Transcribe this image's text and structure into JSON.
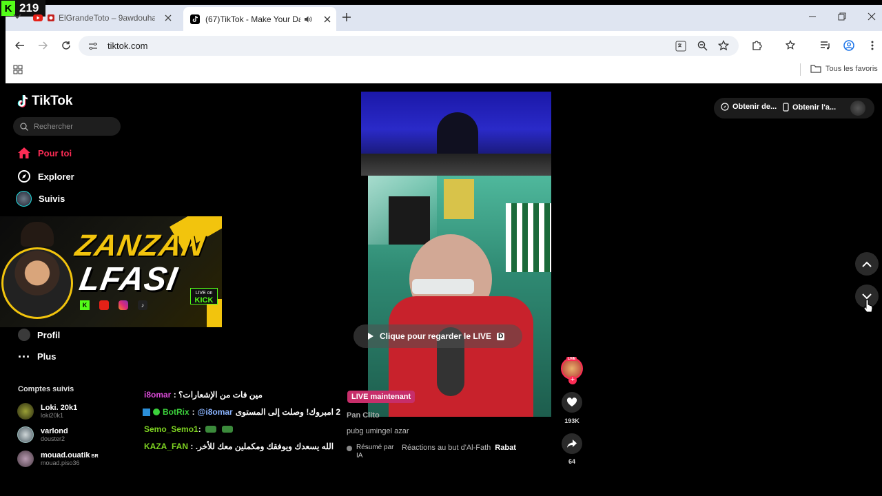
{
  "kick_badge": {
    "count": "219"
  },
  "tabs": [
    {
      "title": "ElGrandeToto – 9awdouha (",
      "active": false,
      "icon": "youtube-icon"
    },
    {
      "title": "(67)TikTok - Make Your Day",
      "active": true,
      "icon": "tiktok-icon"
    }
  ],
  "address_bar": {
    "url": "tiktok.com"
  },
  "bookmarks_bar": {
    "folder_label": "Tous les favoris"
  },
  "tiktok": {
    "logo_text": "TikTok",
    "search_placeholder": "Rechercher",
    "nav": [
      {
        "label": "Pour toi",
        "icon": "home-icon",
        "active": true
      },
      {
        "label": "Explorer",
        "icon": "compass-icon"
      },
      {
        "label": "Suivis",
        "icon": "following-icon"
      },
      {
        "label": "Profil",
        "icon": "profile-icon"
      },
      {
        "label": "Plus",
        "icon": "more-icon"
      }
    ],
    "followed_heading": "Comptes suivis",
    "followed": [
      {
        "name": "Loki. 20k1",
        "handle": "loki20k1"
      },
      {
        "name": "varlond",
        "handle": "douster2"
      },
      {
        "name": "mouad.ouatik",
        "badge": "BR",
        "handle": "mouad.piso36"
      }
    ],
    "top_right": {
      "get_app": "Obtenir de...",
      "get_mobile": "Obtenir l'a..."
    },
    "video": {
      "overlay_text": "Clique pour regarder le LIVE",
      "overlay_key": "D",
      "live_badge": "LIVE maintenant",
      "creator": "Pan Clito",
      "description": "pubg umingel azar",
      "ai_summary_label": "Résumé par IA",
      "related_text": "Réactions au but d'Al-Fath",
      "related_bold": "Rabat"
    },
    "actions": {
      "avatar_badge": "LIVE",
      "likes": "193K",
      "shares": "64"
    }
  },
  "overlay_banner": {
    "line1": "ZANZAN",
    "line2": "LFASI",
    "tagline": "LIVE on",
    "platform": "KICK"
  },
  "chat": [
    {
      "user": "i8omar",
      "sep": " : ",
      "message": "مين فات من الإشعارات؟",
      "color": "#d94ad6"
    },
    {
      "user": "BotRix",
      "sep": " : ",
      "mention": "@i8omar",
      "message": "2 امبروك! وصلت إلى المستوى",
      "color": "#3cd23c"
    },
    {
      "user": "Semo_Semo1",
      "sep": " : ",
      "message": "",
      "color": "#7ed321"
    },
    {
      "user": "KAZA_FAN",
      "sep": " : ",
      "message": "الله يسعدك ويوفقك ومكملين معك للأخر.",
      "color": "#7ed321"
    }
  ],
  "colors": {
    "accent": "#fe2c55",
    "kick_green": "#53fc18",
    "tab_strip": "#dfe5f1"
  }
}
